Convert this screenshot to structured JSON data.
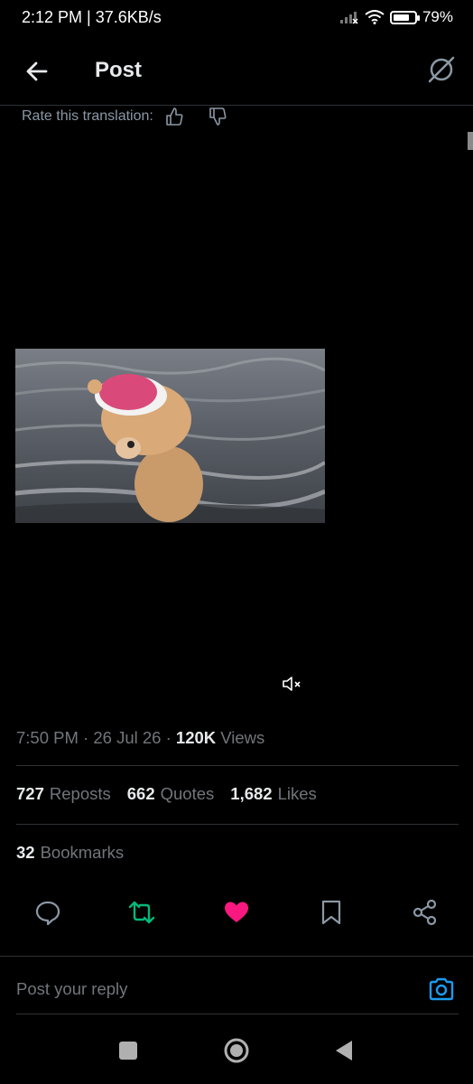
{
  "status_bar": {
    "time_speed": "2:12 PM | 37.6KB/s",
    "battery": "79%",
    "battery_level": 0.79,
    "icons": [
      "signal-icon",
      "wifi-icon",
      "battery-icon"
    ]
  },
  "header": {
    "title": "Post",
    "back_icon": "arrow-left-icon",
    "grok_icon": "grok-icon"
  },
  "translation": {
    "label": "Rate this translation:",
    "icons": [
      "thumbs-up-icon",
      "thumbs-down-icon"
    ]
  },
  "video": {
    "description": "",
    "muted": true
  },
  "meta": {
    "time": "7:50 PM",
    "date": "26 Jul 26",
    "views_count": "120K",
    "views_label": "Views"
  },
  "stats": {
    "reposts_count": "727",
    "reposts_label": "Reposts",
    "quotes_count": "662",
    "quotes_label": "Quotes",
    "likes_count": "1,682",
    "likes_label": "Likes",
    "bookmarks_count": "32",
    "bookmarks_label": "Bookmarks"
  },
  "actions": {
    "icons": [
      "reply-icon",
      "repost-icon",
      "like-icon",
      "bookmark-icon",
      "share-icon"
    ],
    "repost_color": "#00ba7c",
    "like_color": "#f91880"
  },
  "reply": {
    "placeholder": "Post your reply",
    "camera_icon": "camera-icon",
    "camera_color": "#1d9bf0"
  },
  "nav": {
    "icons": [
      "recents-square-icon",
      "home-circle-icon",
      "back-triangle-icon"
    ]
  }
}
